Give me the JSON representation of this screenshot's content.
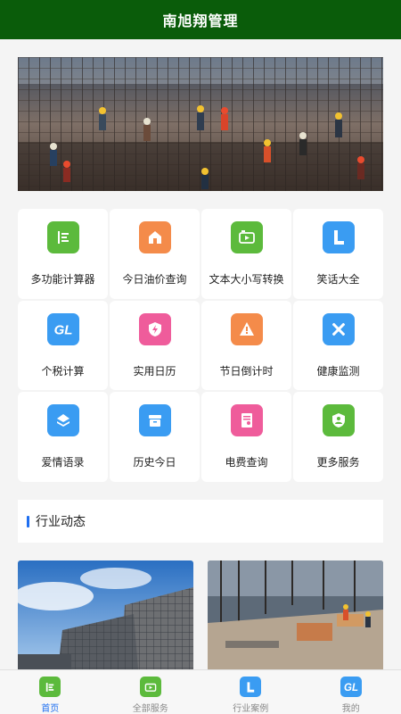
{
  "app": {
    "title": "南旭翔管理"
  },
  "colors": {
    "header_bg": "#0a5c0a",
    "accent_blue": "#1f6ff0",
    "green": "#5cba3c",
    "orange": "#f48b4a",
    "pink": "#ef5c9b",
    "blue": "#3a9cf2"
  },
  "services": [
    {
      "label": "多功能计算器",
      "icon": "calculator-list-icon"
    },
    {
      "label": "今日油价查询",
      "icon": "house-icon"
    },
    {
      "label": "文本大小写转换",
      "icon": "text-convert-icon"
    },
    {
      "label": "笑话大全",
      "icon": "letter-l-icon"
    },
    {
      "label": "个税计算",
      "icon": "gl-icon"
    },
    {
      "label": "实用日历",
      "icon": "shield-bolt-icon"
    },
    {
      "label": "节日倒计时",
      "icon": "warning-icon"
    },
    {
      "label": "健康监测",
      "icon": "tools-icon"
    },
    {
      "label": "爱情语录",
      "icon": "layers-icon"
    },
    {
      "label": "历史今日",
      "icon": "archive-box-icon"
    },
    {
      "label": "电费查询",
      "icon": "document-icon"
    },
    {
      "label": "更多服务",
      "icon": "badge-icon"
    }
  ],
  "news_section": {
    "title": "行业动态"
  },
  "tabs": [
    {
      "label": "首页",
      "icon": "home-list-icon",
      "active": true
    },
    {
      "label": "全部服务",
      "icon": "services-icon",
      "active": false
    },
    {
      "label": "行业案例",
      "icon": "letter-l-icon",
      "active": false
    },
    {
      "label": "我的",
      "icon": "gl-icon",
      "active": false
    }
  ]
}
